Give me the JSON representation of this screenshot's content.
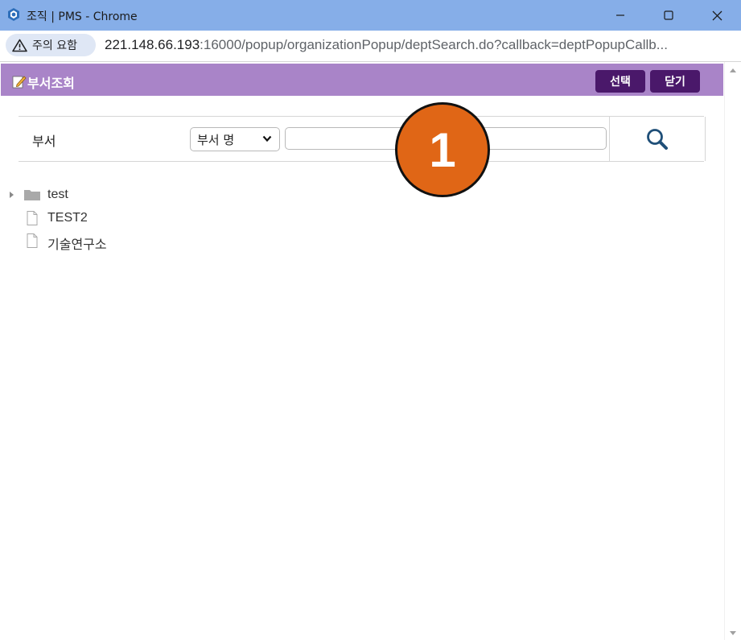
{
  "window": {
    "title": "조직 | PMS - Chrome",
    "app_icon": "chrome-app-icon"
  },
  "addressbar": {
    "warning_label": "주의 요함",
    "url_host": "221.148.66.193",
    "url_rest": ":16000/popup/organizationPopup/deptSearch.do?callback=deptPopupCallb..."
  },
  "header": {
    "title": "부서조회",
    "select_button": "선택",
    "close_button": "닫기"
  },
  "search": {
    "label": "부서",
    "field_select": "부서 명",
    "input_value": "",
    "input_placeholder": ""
  },
  "tree": {
    "items": [
      {
        "label": "test",
        "icon": "folder-icon",
        "expandable": true
      },
      {
        "label": "TEST2",
        "icon": "file-icon",
        "expandable": false
      },
      {
        "label": "기술연구소",
        "icon": "file-icon",
        "expandable": false
      }
    ]
  },
  "annotation": {
    "step_number": "1",
    "color": "#e06616"
  },
  "colors": {
    "titlebar": "#86aee8",
    "header": "#a984c8",
    "header_button": "#4a186a"
  }
}
